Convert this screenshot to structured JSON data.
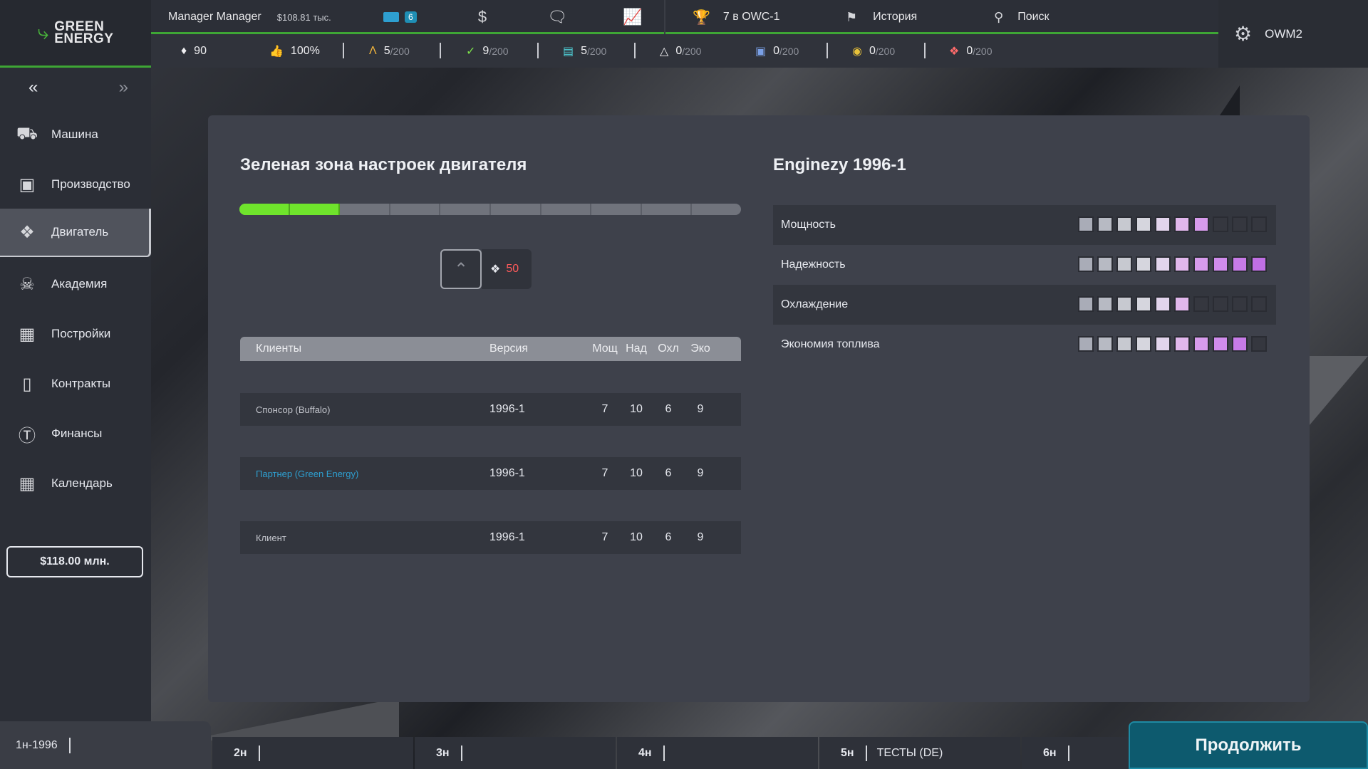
{
  "logo": {
    "line1": "GREEN",
    "line2": "ENERGY",
    "icon": "leaf-icon"
  },
  "topbar": {
    "manager_name": "Manager Manager",
    "manager_funds": "$108.81 тыс.",
    "mail_count": "6",
    "ranking": "7 в OWC-1",
    "history": "История",
    "search": "Поиск",
    "account": "OWM2"
  },
  "stats": [
    {
      "icon": "drop-icon",
      "value": "90",
      "max": ""
    },
    {
      "icon": "thumbs-up-icon",
      "value": "100%",
      "max": ""
    },
    {
      "icon": "compass-icon",
      "value": "5",
      "max": "/200"
    },
    {
      "icon": "wrench-icon",
      "value": "9",
      "max": "/200"
    },
    {
      "icon": "briefcase-icon",
      "value": "5",
      "max": "/200"
    },
    {
      "icon": "flask-icon",
      "value": "0",
      "max": "/200"
    },
    {
      "icon": "car-icon",
      "value": "0",
      "max": "/200"
    },
    {
      "icon": "tire-icon",
      "value": "0",
      "max": "/200"
    },
    {
      "icon": "engine-icon",
      "value": "0",
      "max": "/200"
    }
  ],
  "sidebar": {
    "items": [
      {
        "label": "Машина",
        "icon": "car-icon"
      },
      {
        "label": "Производство",
        "icon": "factory-icon"
      },
      {
        "label": "Двигатель",
        "icon": "engine-icon"
      },
      {
        "label": "Академия",
        "icon": "academy-icon"
      },
      {
        "label": "Постройки",
        "icon": "building-icon"
      },
      {
        "label": "Контракты",
        "icon": "contracts-icon"
      },
      {
        "label": "Финансы",
        "icon": "dollar-icon"
      },
      {
        "label": "Календарь",
        "icon": "calendar-icon"
      }
    ],
    "balance": "$118.00 млн."
  },
  "main": {
    "title": "Зеленая зона настроек двигателя",
    "progress_segments_total": 10,
    "progress_segments_filled": 2,
    "upgrade_cost": "50",
    "table": {
      "headers": {
        "client": "Клиенты",
        "version": "Версия",
        "pow": "Мощ",
        "rel": "Над",
        "cool": "Охл",
        "eco": "Эко"
      },
      "rows": [
        {
          "client": "Спонсор (Buffalo)",
          "version": "1996-1",
          "pow": "7",
          "rel": "10",
          "cool": "6",
          "eco": "9",
          "highlight": false
        },
        {
          "client": "Партнер (Green Energy)",
          "version": "1996-1",
          "pow": "7",
          "rel": "10",
          "cool": "6",
          "eco": "9",
          "highlight": true
        },
        {
          "client": "Клиент",
          "version": "1996-1",
          "pow": "7",
          "rel": "10",
          "cool": "6",
          "eco": "9",
          "highlight": false
        }
      ]
    }
  },
  "engine": {
    "title": "Enginezy 1996-1",
    "attributes": [
      {
        "label": "Мощность",
        "level": 7,
        "max": 10
      },
      {
        "label": "Надежность",
        "level": 10,
        "max": 10
      },
      {
        "label": "Охлаждение",
        "level": 6,
        "max": 10
      },
      {
        "label": "Экономия топлива",
        "level": 9,
        "max": 10
      }
    ],
    "pip_colors": [
      "#a9acb7",
      "#b7bac3",
      "#c7c9d0",
      "#d6d6de",
      "#e2d4ec",
      "#e1b7ec",
      "#d79bec",
      "#d08cec",
      "#c77be8",
      "#c06fe4"
    ],
    "pip_empty_color": "#35373f"
  },
  "timeline": {
    "current_week": "1н-1996",
    "weeks": [
      {
        "label": "2н",
        "event": ""
      },
      {
        "label": "3н",
        "event": ""
      },
      {
        "label": "4н",
        "event": ""
      },
      {
        "label": "5н",
        "event": "ТЕСТЫ (DE)"
      },
      {
        "label": "6н",
        "event": ""
      }
    ],
    "continue": "Продолжить"
  },
  "colors": {
    "accent_green": "#3ea635",
    "progress_green": "#6fe42c",
    "link_blue": "#2e9fd0",
    "cost_red": "#ff5b5b",
    "continue_bg": "#0d5a6e"
  }
}
